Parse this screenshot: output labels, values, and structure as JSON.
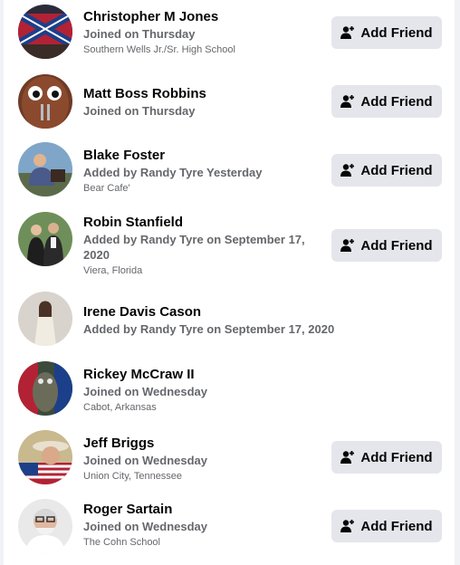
{
  "people": [
    {
      "name": "Christopher M Jones",
      "meta": "Joined on Thursday",
      "sub": "Southern Wells Jr./Sr. High School",
      "button": "Add Friend",
      "avatar_icon": "profile-photo-icon"
    },
    {
      "name": "Matt Boss Robbins",
      "meta": "Joined on Thursday",
      "sub": "",
      "button": "Add Friend",
      "avatar_icon": "profile-photo-icon"
    },
    {
      "name": "Blake Foster",
      "meta": "Added by Randy Tyre Yesterday",
      "sub": "Bear Cafe'",
      "button": "Add Friend",
      "avatar_icon": "profile-photo-icon"
    },
    {
      "name": "Robin Stanfield",
      "meta": "Added by Randy Tyre on September 17, 2020",
      "sub": "Viera, Florida",
      "button": "Add Friend",
      "avatar_icon": "profile-photo-icon"
    },
    {
      "name": "Irene Davis Cason",
      "meta": "Added by Randy Tyre on September 17, 2020",
      "sub": "",
      "button": "",
      "avatar_icon": "profile-photo-icon"
    },
    {
      "name": "Rickey McCraw II",
      "meta": "Joined on Wednesday",
      "sub": "Cabot, Arkansas",
      "button": "",
      "avatar_icon": "profile-photo-icon"
    },
    {
      "name": "Jeff Briggs",
      "meta": "Joined on Wednesday",
      "sub": "Union City, Tennessee",
      "button": "Add Friend",
      "avatar_icon": "profile-photo-icon"
    },
    {
      "name": "Roger Sartain",
      "meta": "Joined on Wednesday",
      "sub": "The Cohn School",
      "button": "Add Friend",
      "avatar_icon": "profile-photo-icon"
    }
  ],
  "colors": {
    "button_bg": "#e4e6eb",
    "name_text": "#050505",
    "secondary_text": "#65676b"
  },
  "icons": {
    "add_friend": "add-friend-icon"
  }
}
